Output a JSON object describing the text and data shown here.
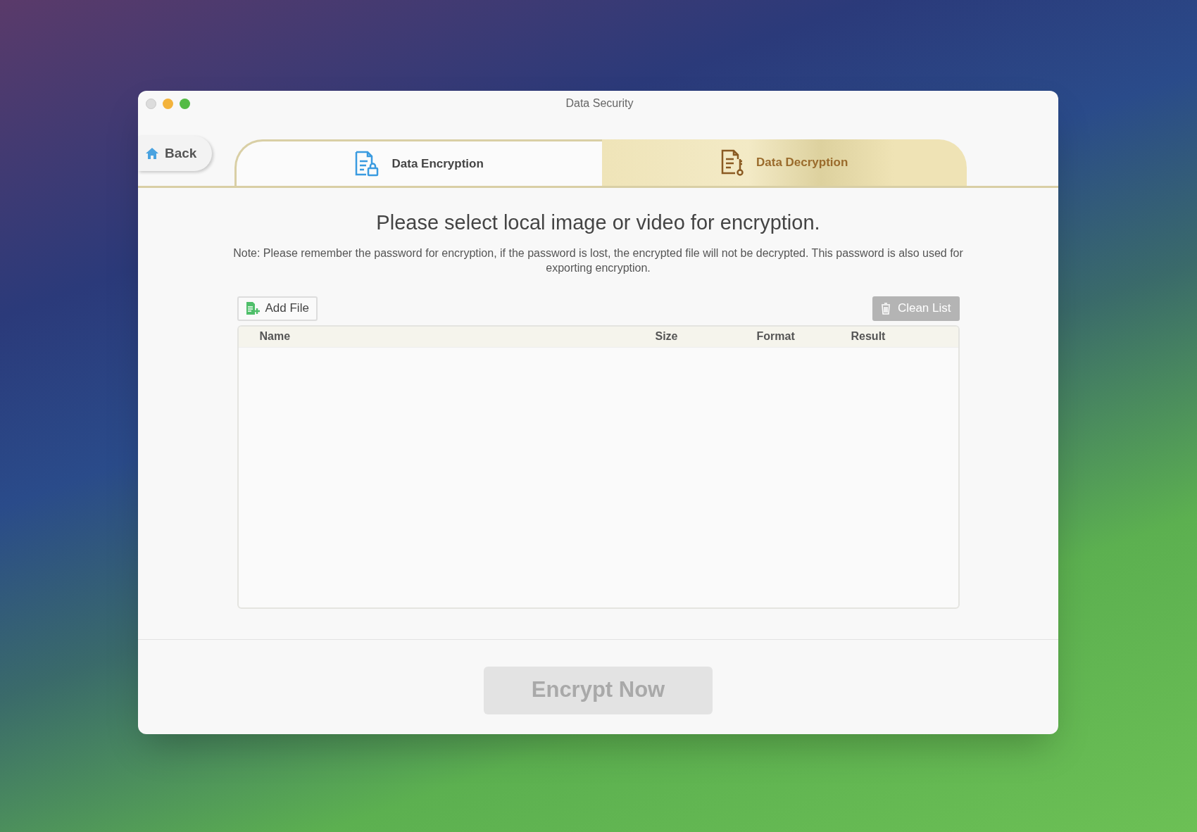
{
  "window": {
    "title": "Data Security"
  },
  "back_button": {
    "label": "Back"
  },
  "tabs": [
    {
      "label": "Data Encryption",
      "kind": "encrypt",
      "selected": true
    },
    {
      "label": "Data Decryption",
      "kind": "decrypt",
      "selected": false
    }
  ],
  "heading": "Please select local image or video for encryption.",
  "note": "Note: Please remember the password for encryption, if the password is lost, the encrypted file will not be decrypted. This password is also used for exporting encryption.",
  "toolbar": {
    "add_file": {
      "label": "Add File",
      "disabled": false
    },
    "clean_list": {
      "label": "Clean List",
      "disabled": true
    }
  },
  "table": {
    "columns": [
      "Name",
      "Size",
      "Format",
      "Result"
    ]
  },
  "encrypt_button": {
    "label": "Encrypt Now",
    "disabled": true
  }
}
